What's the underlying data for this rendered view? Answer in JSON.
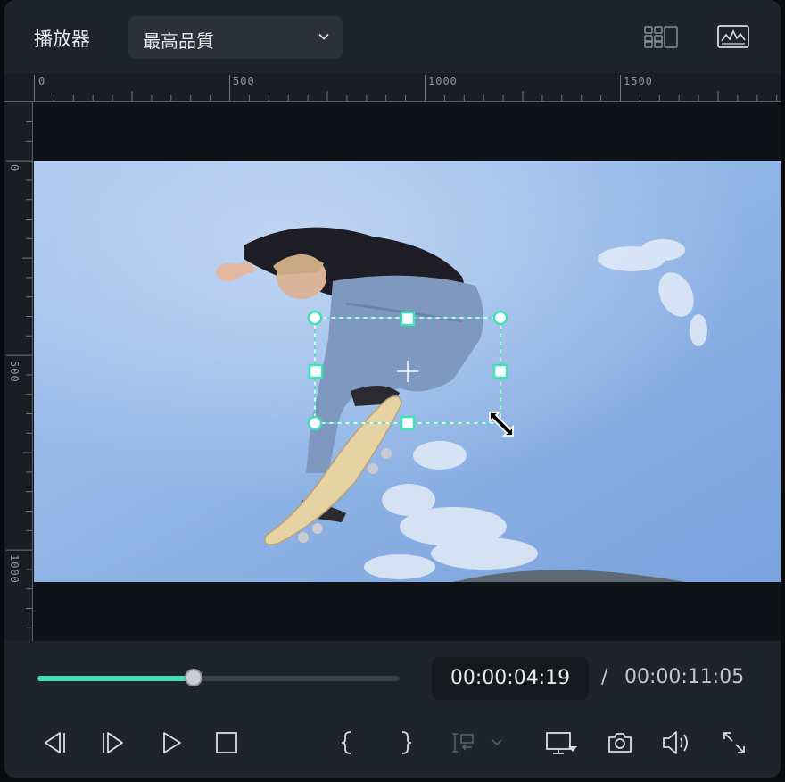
{
  "header": {
    "title": "播放器",
    "quality_value": "最高品質"
  },
  "ruler": {
    "h_labels": [
      "0",
      "500",
      "1000",
      "1500"
    ],
    "v_labels": [
      "0",
      "500",
      "1000"
    ]
  },
  "playback": {
    "progress": 0.43,
    "current_time": "00:00:04:19",
    "separator": "/",
    "total_time": "00:00:11:05"
  },
  "colors": {
    "accent": "#3ee0b5",
    "panel": "#1f232b",
    "sky": "#8fb6e8"
  },
  "icons": {
    "layout": "grid-layout-icon",
    "scopes": "waveform-icon",
    "prev_frame": "previous-frame-icon",
    "next_frame": "next-frame-icon",
    "play": "play-icon",
    "stop": "stop-icon",
    "mark_in": "mark-in-icon",
    "mark_out": "mark-out-icon",
    "insert": "insert-icon",
    "display": "display-icon",
    "snapshot": "camera-icon",
    "volume": "volume-icon",
    "fullscreen": "fullscreen-icon"
  }
}
